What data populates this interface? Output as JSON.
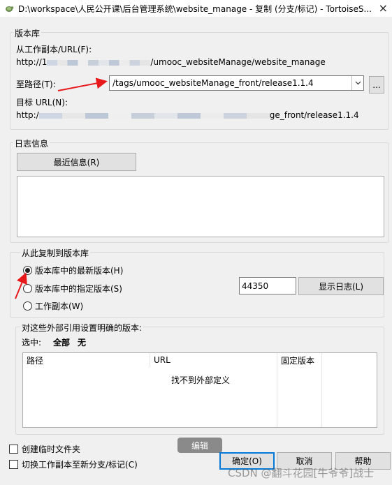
{
  "window": {
    "title": "D:\\workspace\\人民公开课\\后台管理系统\\website_manage - 复制 (分支/标记) - TortoiseS...",
    "close_glyph": "×"
  },
  "repository": {
    "group_title": "版本库",
    "from_label": "从工作副本/URL(F):",
    "from_url_prefix": "http://1",
    "from_url_suffix": "/umooc_websiteManage/website_manage",
    "to_label": "至路径(T):",
    "to_path": "/tags/umooc_websiteManage_front/release1.1.4",
    "browse_label": "...",
    "target_label": "目标 URL(N):",
    "target_url_prefix": "http:/",
    "target_url_suffix": "ge_front/release1.1.4"
  },
  "log": {
    "group_title": "日志信息",
    "recent_button": "最近信息(R)"
  },
  "copy_from": {
    "group_title": "从此复制到版本库",
    "options": [
      {
        "label": "版本库中的最新版本(H)",
        "checked": true
      },
      {
        "label": "版本库中的指定版本(S)",
        "checked": false
      },
      {
        "label": "工作副本(W)",
        "checked": false
      }
    ],
    "revision_value": "44350",
    "show_log_button": "显示日志(L)"
  },
  "externals": {
    "group_title": "对这些外部引用设置明确的版本:",
    "select_label": "选中:",
    "select_all": "全部",
    "select_none": "无",
    "columns": [
      "路径",
      "URL",
      "固定版本"
    ],
    "empty_message": "找不到外部定义"
  },
  "options": {
    "create_intermediate": "创建临时文件夹",
    "switch_wc": "切换工作副本至新分支/标记(C)"
  },
  "overlay": {
    "edit_label": "编辑",
    "watermark": "CSDN @翻斗花园[牛爷爷]战士"
  },
  "footer": {
    "ok": "确定(O)",
    "cancel": "取消",
    "help": "帮助"
  },
  "colors": {
    "annotation_arrow": "#e8191b",
    "default_button_border": "#0078d7"
  }
}
